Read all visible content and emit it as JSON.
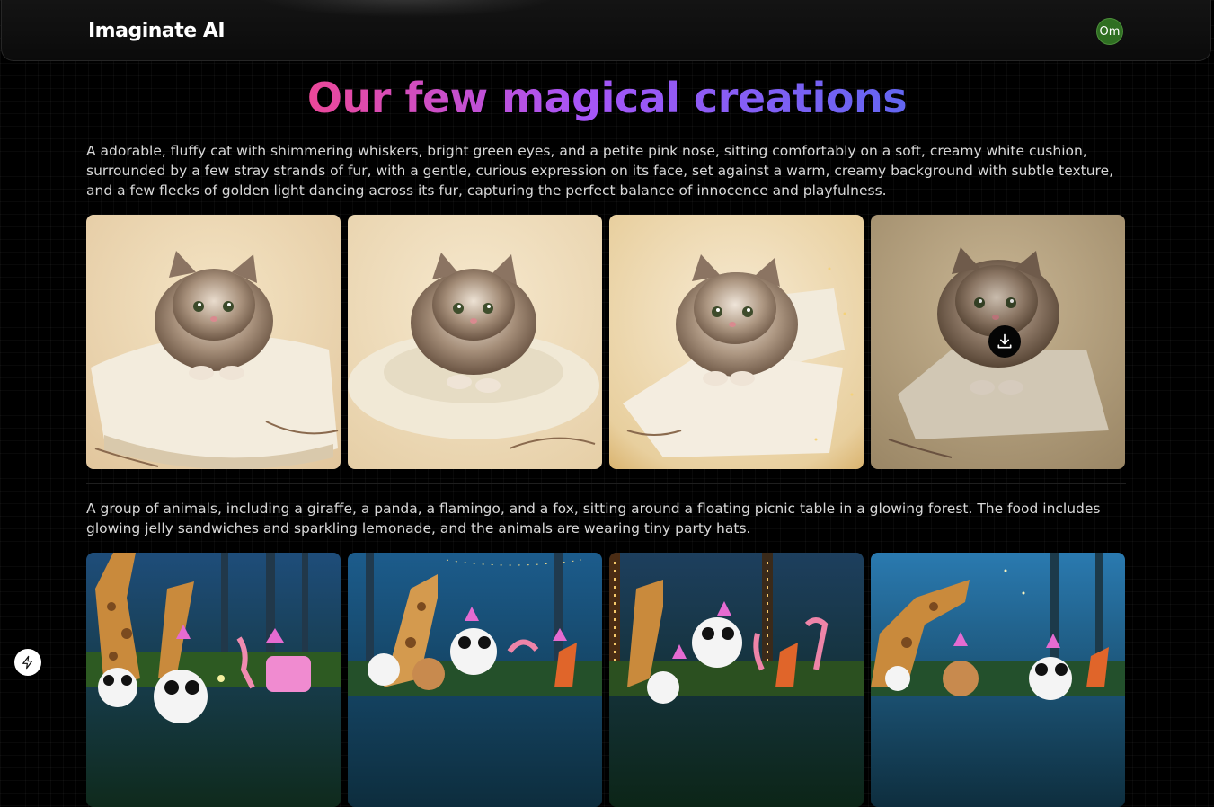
{
  "app": {
    "brand": "Imaginate AI",
    "avatar_initials": "Om",
    "avatar_color": "#2f6f22"
  },
  "page": {
    "title": "Our few magical creations",
    "title_gradient": [
      "#ec4899",
      "#a855f7",
      "#6366f1"
    ]
  },
  "creations": [
    {
      "prompt": "A adorable, fluffy cat with shimmering whiskers, bright green eyes, and a petite pink nose, sitting comfortably on a soft, creamy white cushion, surrounded by a few stray strands of fur, with a gentle, curious expression on its face, set against a warm, creamy background with subtle texture, and a few flecks of golden light dancing across its fur, capturing the perfect balance of innocence and playfulness.",
      "images": [
        {
          "subject": "fluffy kitten on cream cushion"
        },
        {
          "subject": "fluffy kitten on round cushion"
        },
        {
          "subject": "fluffy kitten on pillow with gold sparkles"
        },
        {
          "subject": "fluffy kitten on pillow, darker tone",
          "download_icon": "download-icon"
        }
      ]
    },
    {
      "prompt": "A group of animals, including a giraffe, a panda, a flamingo, and a fox, sitting around a floating picnic table in a glowing forest. The food includes glowing jelly sandwiches and sparkling lemonade, and the animals are wearing tiny party hats.",
      "images": [
        {
          "subject": "animal picnic in glowing forest"
        },
        {
          "subject": "animal picnic with string lights"
        },
        {
          "subject": "animal picnic among lit trees"
        },
        {
          "subject": "animal picnic in blue forest"
        }
      ]
    }
  ],
  "floating_action": {
    "icon": "bolt-icon"
  }
}
